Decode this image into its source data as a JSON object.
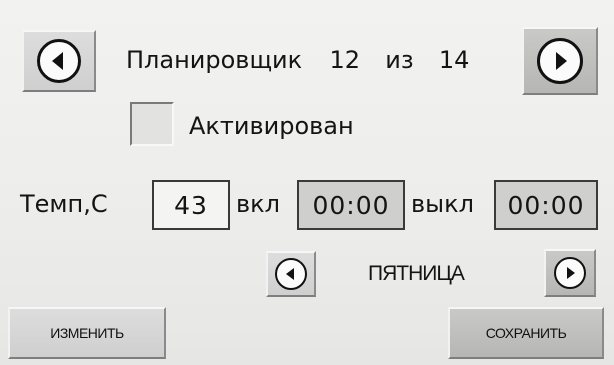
{
  "header": {
    "title": "Планировщик",
    "current": "12",
    "separator": "из",
    "total": "14"
  },
  "activation": {
    "label": "Активирован",
    "checked": false
  },
  "temperature": {
    "label": "Темп,С",
    "value": "43"
  },
  "on_time": {
    "label": "вкл",
    "value": "00:00"
  },
  "off_time": {
    "label": "выкл",
    "value": "00:00"
  },
  "day": {
    "value": "ПЯТНИЦА"
  },
  "buttons": {
    "edit_label": "ИЗМЕНИТЬ",
    "save_label": "СОХРАНИТЬ"
  },
  "icons": {
    "prev": "arrow-left-circle-icon",
    "next": "arrow-right-circle-icon"
  }
}
